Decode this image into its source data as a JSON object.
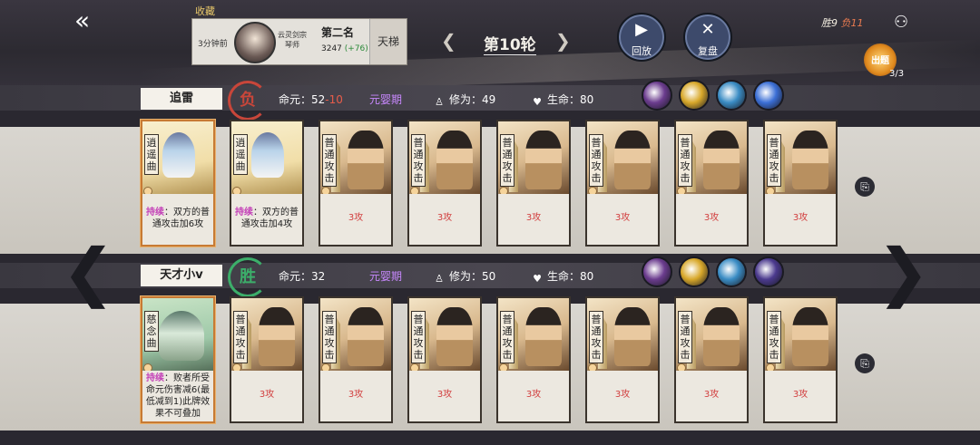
{
  "header": {
    "fav_label": "收藏",
    "time_ago": "3分钟前",
    "sect_name": "云灵剑宗 琴师",
    "rank": "第二名",
    "score": "3247",
    "score_delta": "(+76)",
    "ladder": "天梯",
    "round_label": "第10轮",
    "replay_label": "回放",
    "review_label": "复盘",
    "record_win": "胜9",
    "record_loss": "负11",
    "chuzhao_label": "出题",
    "chuzhao_count": "3/3"
  },
  "players": [
    {
      "name": "追雷",
      "result": "负",
      "life_label": "命元：",
      "life_value": "52",
      "life_delta": "-10",
      "realm": "元婴期",
      "cult_label": "修为：",
      "cult_value": "49",
      "hp_label": "生命：",
      "hp_value": "80",
      "orb_colors": [
        "#6b3c8e",
        "#d8a82a",
        "#3a8cc4",
        "#3b6fd6"
      ],
      "cards": [
        {
          "name": "逍遥曲",
          "tag": "持续",
          "desc": "：双方的普通攻击加6攻"
        },
        {
          "name": "逍遥曲",
          "tag": "持续",
          "desc": "：双方的普通攻击加4攻"
        },
        {
          "name": "普通攻击",
          "desc": "3攻"
        },
        {
          "name": "普通攻击",
          "desc": "3攻"
        },
        {
          "name": "普通攻击",
          "desc": "3攻"
        },
        {
          "name": "普通攻击",
          "desc": "3攻"
        },
        {
          "name": "普通攻击",
          "desc": "3攻"
        },
        {
          "name": "普通攻击",
          "desc": "3攻"
        }
      ]
    },
    {
      "name": "天才小v",
      "result": "胜",
      "life_label": "命元：",
      "life_value": "32",
      "realm": "元婴期",
      "cult_label": "修为：",
      "cult_value": "50",
      "hp_label": "生命：",
      "hp_value": "80",
      "orb_colors": [
        "#6b3c8e",
        "#d8a82a",
        "#3a8cc4",
        "#4b3a8e"
      ],
      "cards": [
        {
          "name": "慈念曲",
          "tag": "持续",
          "desc": "：败者所受命元伤害减6(最低减到1)此牌效果不可叠加"
        },
        {
          "name": "普通攻击",
          "desc": "3攻"
        },
        {
          "name": "普通攻击",
          "desc": "3攻"
        },
        {
          "name": "普通攻击",
          "desc": "3攻"
        },
        {
          "name": "普通攻击",
          "desc": "3攻"
        },
        {
          "name": "普通攻击",
          "desc": "3攻"
        },
        {
          "name": "普通攻击",
          "desc": "3攻"
        },
        {
          "name": "普通攻击",
          "desc": "3攻"
        }
      ]
    }
  ],
  "icons": {
    "back": "double-chevron-left-icon",
    "prev_round": "chevron-left-icon",
    "next_round": "chevron-right-icon",
    "replay": "play-icon",
    "review": "crossed-swords-icon",
    "network": "network-icon",
    "deck": "deck-icon"
  }
}
